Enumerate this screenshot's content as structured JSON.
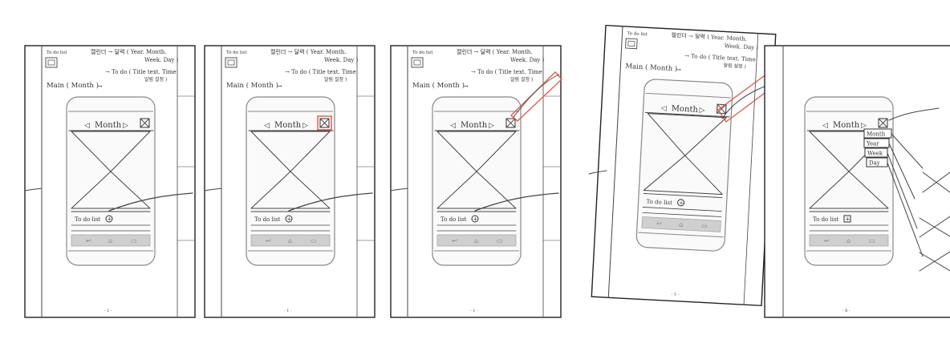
{
  "common": {
    "app_label": "To do list",
    "note_line1": "캘린더 → 달력 ( Year. Month.",
    "note_line2": "Week. Day )",
    "note_line3": "→ To do ( Title text. Time",
    "note_line4": "알림 설정 )",
    "main_label": "Main ( Month )",
    "arrow_glyph": "→",
    "header_text": "Month",
    "prev_glyph": "◁",
    "next_glyph": "▷",
    "todo_label": "To do list",
    "plus_glyph": "+"
  },
  "pages": [
    {
      "page_number": "- 1 -"
    },
    {
      "page_number": "- 1 -"
    },
    {
      "page_number": "- 1 -"
    },
    {
      "page_number": "- 1 -"
    },
    {
      "page_number": "- 6 -"
    }
  ],
  "view_menu": [
    "Month",
    "Year",
    "Week",
    "Day"
  ],
  "colors": {
    "highlight": "#e8543f",
    "ink": "#333333",
    "navbar": "#cfcfcf"
  }
}
